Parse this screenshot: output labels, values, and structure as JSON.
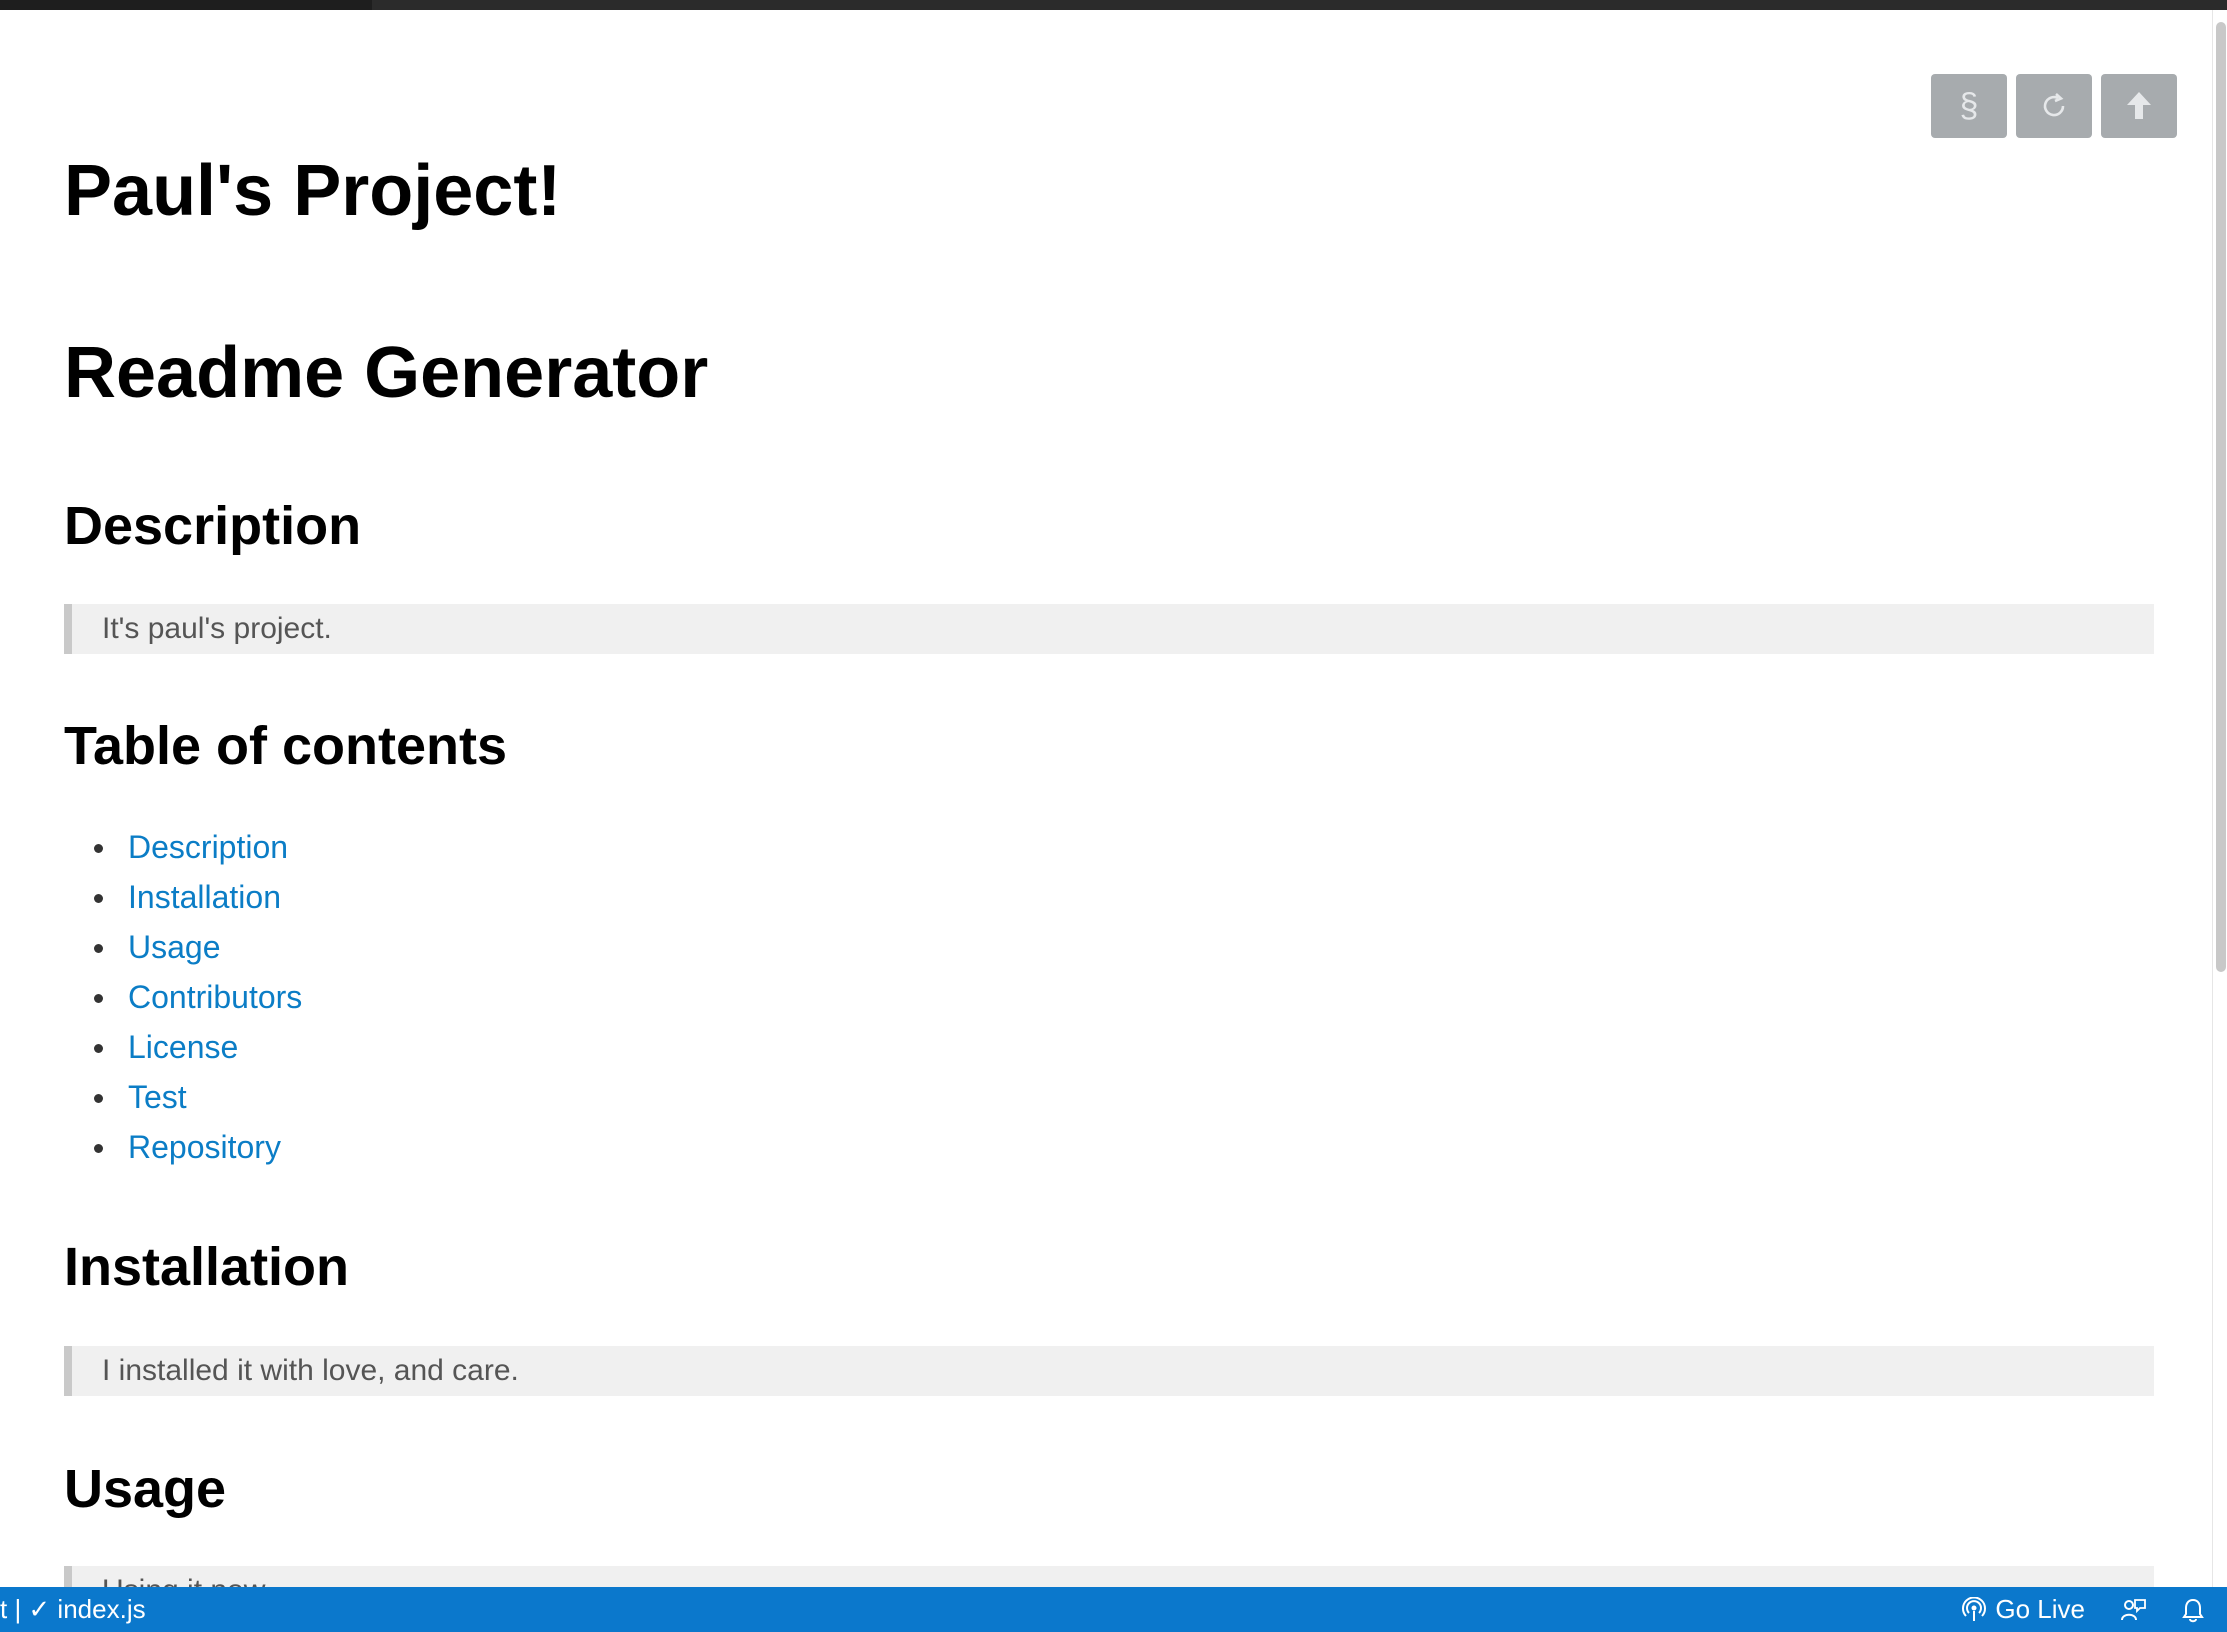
{
  "toolbar": {
    "section_icon": "§",
    "refresh_icon": "⟳",
    "upload_icon": "⬆"
  },
  "doc": {
    "title": "Paul's Project!",
    "subtitle": "Readme Generator",
    "description_heading": "Description",
    "description_text": "It's paul's project.",
    "toc_heading": "Table of contents",
    "toc_items": [
      "Description",
      "Installation",
      "Usage",
      "Contributors",
      "License",
      "Test",
      "Repository"
    ],
    "installation_heading": "Installation",
    "installation_text": "I installed it with love, and care.",
    "usage_heading": "Usage",
    "usage_text": "Using it now."
  },
  "statusbar": {
    "left_text": "t | ✓ index.js",
    "go_live_label": "Go Live"
  },
  "colors": {
    "link": "#0b7dc6",
    "statusbar": "#0b78cc",
    "toolbar_button": "#a7abae",
    "blockquote_bg": "#f0f0f0"
  }
}
